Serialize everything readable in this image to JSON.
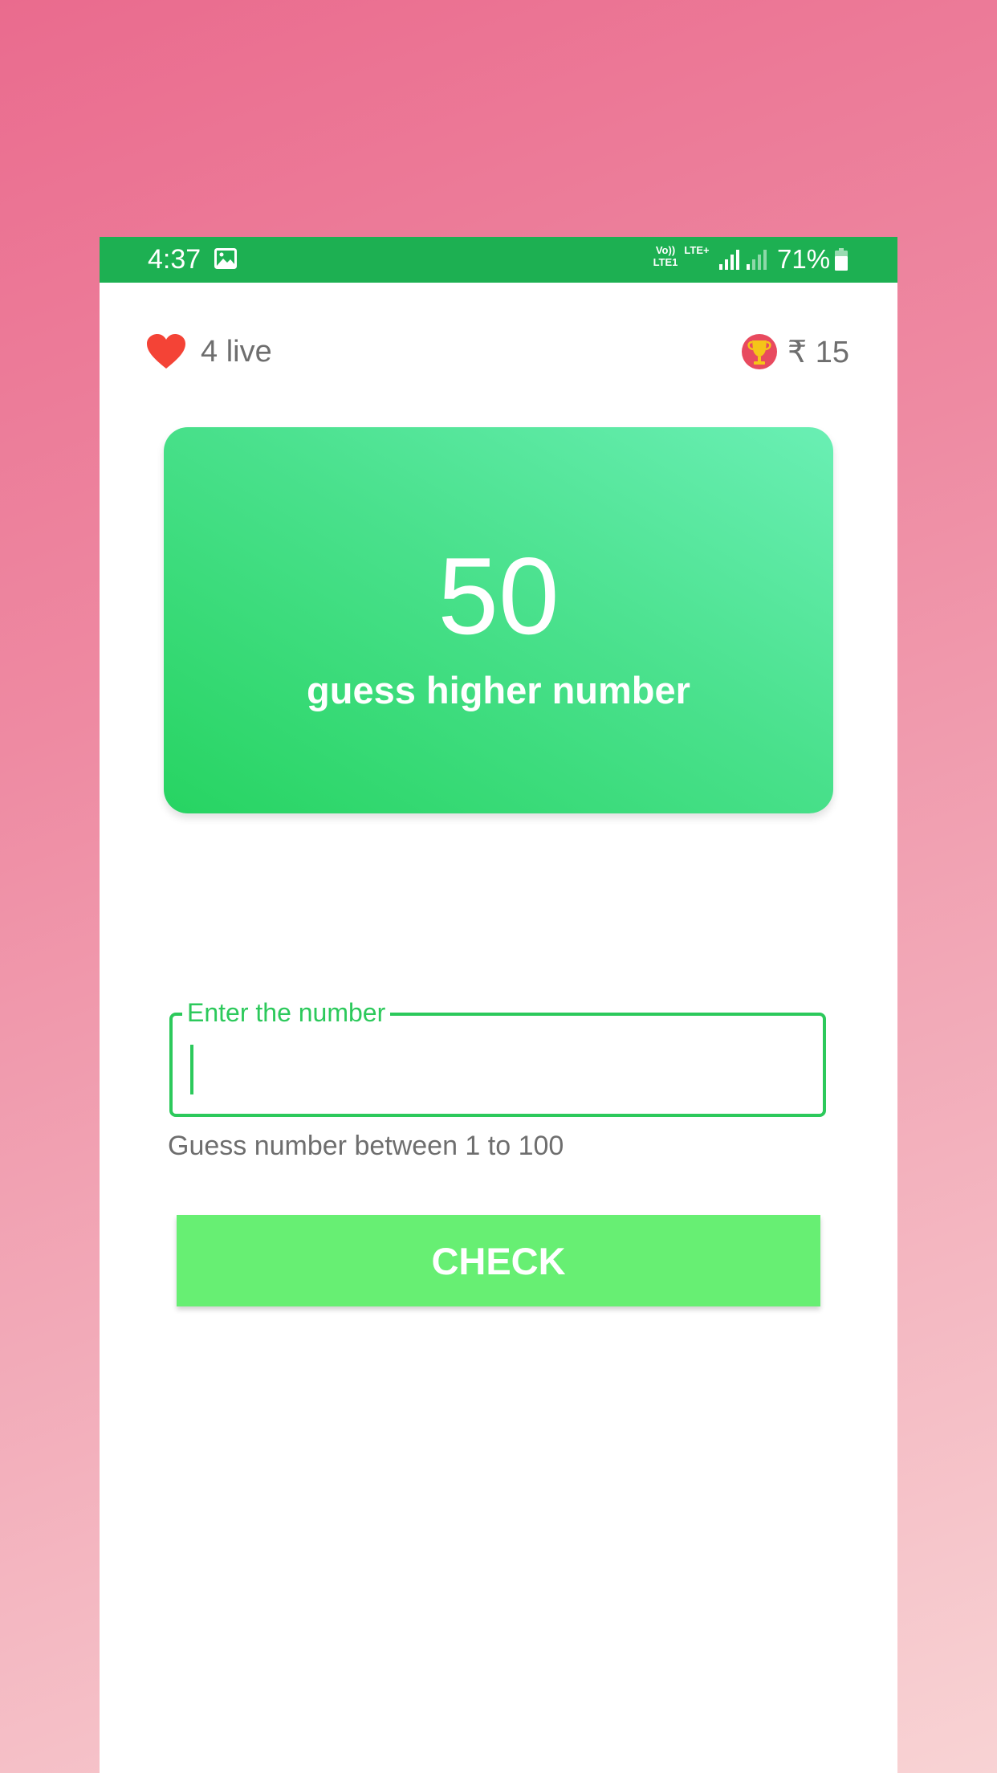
{
  "status_bar": {
    "time": "4:37",
    "network_top": "Vo)) LTE+",
    "network_label_1": "Vo))\nLTE1",
    "network_label_2": "LTE+",
    "battery": "71%",
    "icons": [
      "gallery-icon",
      "signal-icon",
      "signal-icon",
      "battery-icon"
    ]
  },
  "header": {
    "lives_text": "4 live",
    "coins_text": "₹ 15",
    "icons": [
      "heart-icon",
      "trophy-icon"
    ]
  },
  "card": {
    "number": "50",
    "hint": "guess higher number"
  },
  "input": {
    "label": "Enter the number",
    "value": "",
    "helper": "Guess number between 1 to 100"
  },
  "check_button": {
    "label": "CHECK"
  },
  "colors": {
    "status_bar": "#1db052",
    "accent_green": "#2cc95b",
    "button_green": "#67ef73",
    "heart_red": "#f44336"
  }
}
